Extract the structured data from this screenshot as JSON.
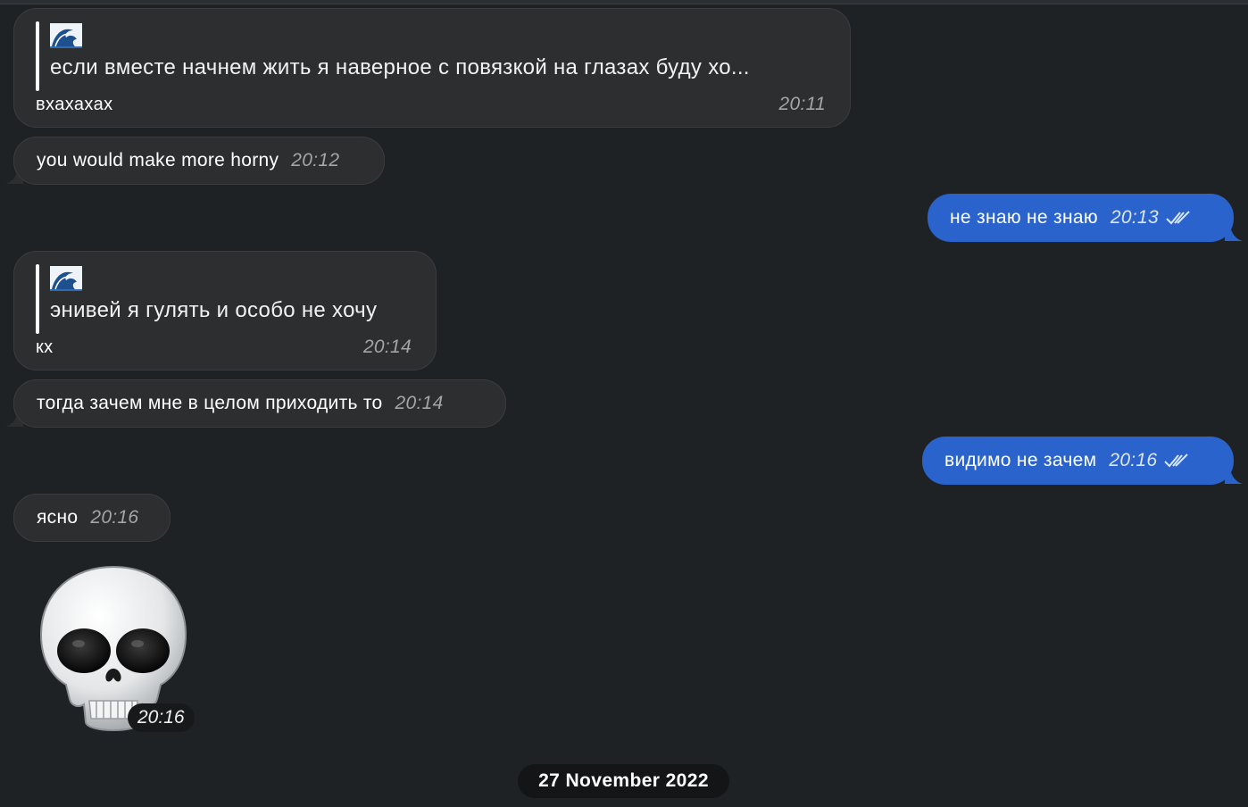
{
  "messages": [
    {
      "reply_text": "если вместе начнем жить я наверное с повязкой на глазах буду хо...",
      "text": "вхахахах",
      "time": "20:11"
    },
    {
      "text": "you would make more horny",
      "time": "20:12"
    },
    {
      "text": "не знаю не знаю",
      "time": "20:13"
    },
    {
      "reply_text": "энивей я гулять и особо не хочу",
      "text": "кх",
      "time": "20:14"
    },
    {
      "text": "тогда зачем мне в целом приходить то",
      "time": "20:14"
    },
    {
      "text": "видимо не зачем",
      "time": "20:16"
    },
    {
      "text": "ясно",
      "time": "20:16"
    },
    {
      "sticker": "skull-emoji",
      "time": "20:16"
    }
  ],
  "date_separator": "27 November 2022",
  "colors": {
    "background": "#1f2225",
    "incoming_bubble": "#2d2e30",
    "outgoing_bubble": "#2a63cc",
    "timestamp": "#a3a5aa"
  }
}
